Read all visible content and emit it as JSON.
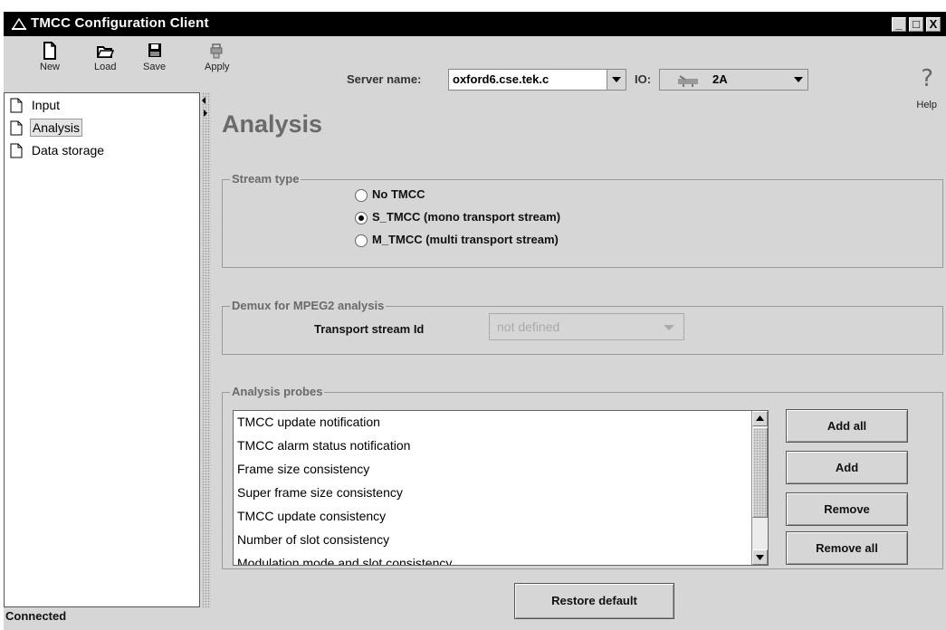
{
  "window": {
    "title": "TMCC Configuration Client"
  },
  "toolbar": {
    "new_label": "New",
    "load_label": "Load",
    "save_label": "Save",
    "apply_label": "Apply",
    "server_label": "Server name:",
    "server_value": "oxford6.cse.tek.c",
    "io_label": "IO:",
    "io_value": "2A",
    "help_label": "Help"
  },
  "tree": {
    "items": [
      {
        "label": "Input",
        "selected": false
      },
      {
        "label": "Analysis",
        "selected": true
      },
      {
        "label": "Data storage",
        "selected": false
      }
    ]
  },
  "main": {
    "title": "Analysis",
    "stream_type": {
      "title": "Stream type",
      "options": [
        {
          "label": "No TMCC",
          "selected": false
        },
        {
          "label": "S_TMCC (mono transport stream)",
          "selected": true
        },
        {
          "label": "M_TMCC (multi transport stream)",
          "selected": false
        }
      ]
    },
    "demux": {
      "title": "Demux for MPEG2 analysis",
      "field_label": "Transport stream Id",
      "field_value": "not defined"
    },
    "probes": {
      "title": "Analysis probes",
      "items": [
        "TMCC update notification",
        "TMCC alarm status notification",
        "Frame size consistency",
        "Super frame size consistency",
        "TMCC update consistency",
        "Number of slot consistency",
        "Modulation mode and slot consistency"
      ],
      "add_all_label": "Add all",
      "add_label": "Add",
      "remove_label": "Remove",
      "remove_all_label": "Remove all"
    },
    "restore_label": "Restore default"
  },
  "status": {
    "text": "Connected"
  },
  "colors": {
    "window_bg": "#d6d6d6",
    "titlebar": "#000000",
    "heading": "#6a6a6a"
  },
  "icons": [
    "app-icon",
    "new-file-icon",
    "open-folder-icon",
    "save-disk-icon",
    "apply-icon",
    "io-device-icon",
    "help-icon",
    "document-icon"
  ]
}
